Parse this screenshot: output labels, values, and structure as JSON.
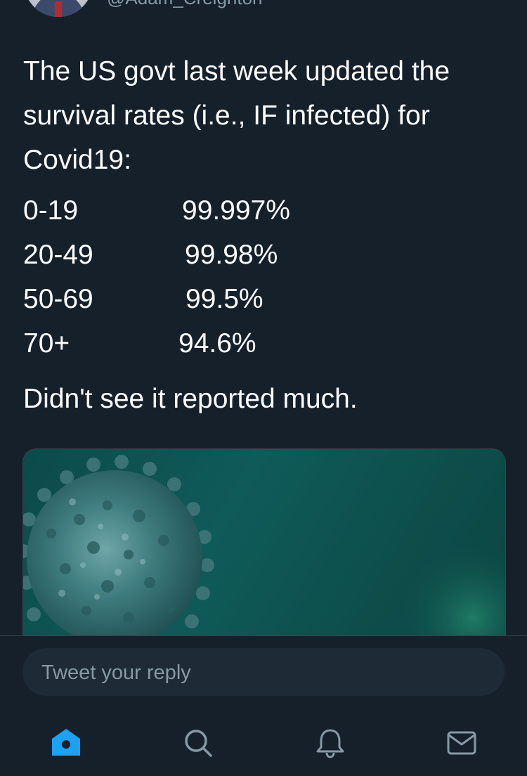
{
  "author": {
    "handle": "@Adam_Creighton"
  },
  "tweet": {
    "intro": "The US govt last week updated the survival rates (i.e., IF infected) for Covid19:",
    "survival_rates": [
      {
        "age": "0-19",
        "rate": "99.997%"
      },
      {
        "age": "20-49",
        "rate": "99.98%"
      },
      {
        "age": "50-69",
        "rate": "99.5%"
      },
      {
        "age": "70+",
        "rate": "94.6%"
      }
    ],
    "footer": "Didn't see it reported much."
  },
  "reply": {
    "placeholder": "Tweet your reply"
  },
  "tabbar": {
    "icons": [
      "home-icon",
      "search-icon",
      "bell-icon",
      "mail-icon"
    ],
    "active": "home-icon"
  },
  "colors": {
    "background": "#15202b",
    "accent": "#1da1f2",
    "secondary_text": "#8899a6"
  }
}
